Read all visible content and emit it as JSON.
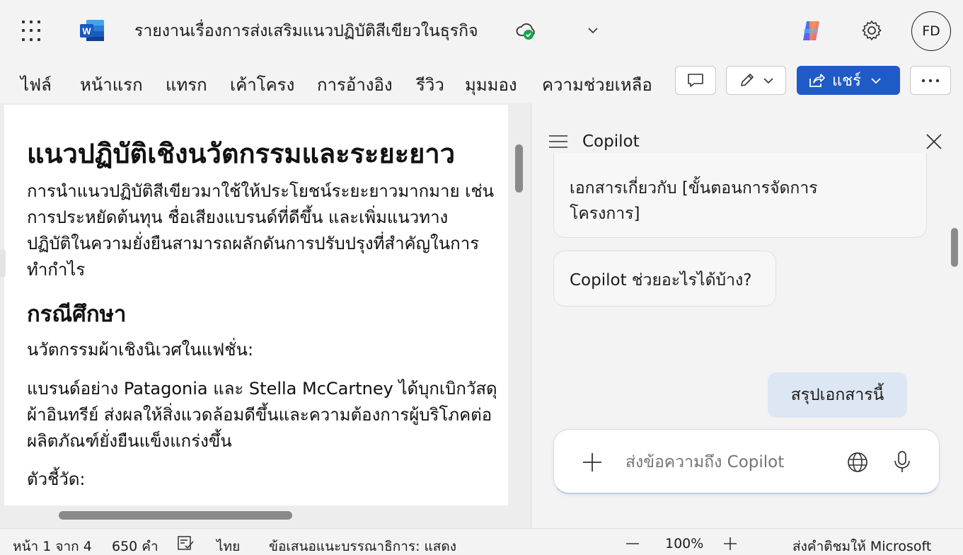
{
  "titlebar": {
    "doc_title": "รายงานเรื่องการส่งเสริมแนวปฏิบัติสีเขียวในธุรกิจ",
    "avatar_initials": "FD",
    "app_logo_letter": "W"
  },
  "ribbon": {
    "menu": [
      "ไฟล์",
      "หน้าแรก",
      "แทรก",
      "เค้าโครง",
      "การอ้างอิง",
      "รีวิว",
      "มุมมอง",
      "ความช่วยเหลือ"
    ],
    "share_label": "แชร์"
  },
  "document": {
    "heading1": "แนวปฏิบัติเชิงนวัตกรรมและระยะยาว",
    "para1": [
      "การนำแนวปฏิบัติสีเขียวมาใช้ให้ประโยชน์ระยะยาวมากมาย เช่น",
      "การประหยัดต้นทุน ชื่อเสียงแบรนด์ที่ดีขึ้น และเพิ่มแนวทาง",
      "ปฏิบัติในความยั่งยืนสามารถผลักดันการปรับปรุงที่สำคัญในการ",
      "ทำกำไร"
    ],
    "heading2": "กรณีศึกษา",
    "subheading": "นวัตกรรมผ้าเชิงนิเวศในแฟชั่น:",
    "para2": [
      "แบรนด์อย่าง Patagonia และ Stella McCartney ได้บุกเบิกวัสดุ",
      "ผ้าอินทรีย์ ส่งผลให้สิ่งแวดล้อมดีขึ้นและความต้องการผู้บริโภคต่อ",
      "ผลิตภัณฑ์ยั่งยืนแข็งแกร่งขึ้น"
    ],
    "metric_label": "ตัวชี้วัด:"
  },
  "copilot": {
    "title": "Copilot",
    "bubble1_lines": [
      "เอกสารเกี่ยวกับ [ขั้นตอนการจัดการ",
      "โครงการ]"
    ],
    "bubble2": "Copilot ช่วยอะไรได้บ้าง?",
    "user_message": "สรุปเอกสารนี้",
    "composer_placeholder": "ส่งข้อความถึง Copilot"
  },
  "statusbar": {
    "page": "หน้า 1 จาก 4",
    "words": "650 คำ",
    "language": "ไทย",
    "suggestions": "ข้อเสนอแนะบรรณาธิการ: แสดง",
    "zoom": "100%",
    "feedback": "ส่งคำติชมให้ Microsoft"
  },
  "colors": {
    "share_button": "#1f5bc6",
    "word_blue": "#185abd",
    "user_bubble": "#dde6f3",
    "sync_check": "#16a34a"
  }
}
